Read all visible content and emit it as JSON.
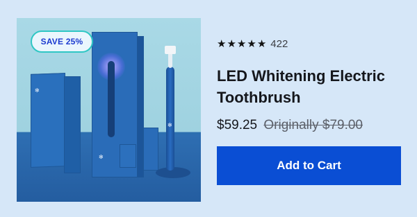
{
  "product": {
    "image_alt_icon": "toothbrush-product-photo",
    "badge": "SAVE 25%",
    "rating": {
      "stars": 5,
      "star_glyph": "★",
      "count": "422"
    },
    "title": "LED Whitening Electric Toothbrush",
    "price": "$59.25",
    "original_price": "Originally $79.00"
  },
  "actions": {
    "add_to_cart": "Add to Cart"
  },
  "colors": {
    "background": "#d6e7f8",
    "button": "#0a4ed4",
    "badge_text": "#1c3bd0",
    "badge_border": "#2fc7c4"
  }
}
